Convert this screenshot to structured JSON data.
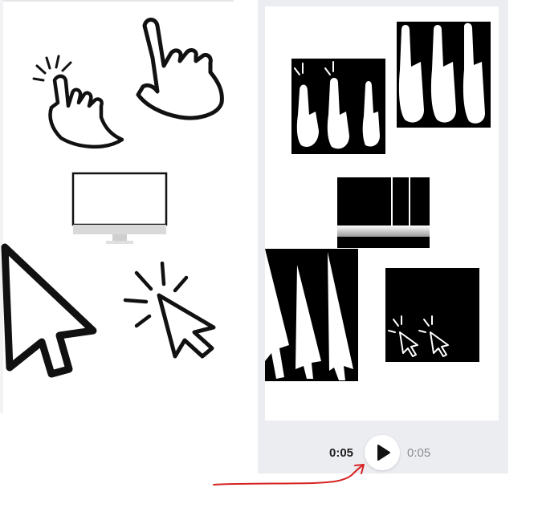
{
  "player": {
    "current_time": "0:05",
    "total_time": "0:05",
    "play_icon": "play-icon"
  },
  "icons": {
    "left_panel": [
      "tap-hand-icon",
      "pointing-hand-icon",
      "monitor-icon",
      "arrow-cursor-icon",
      "click-cursor-icon"
    ],
    "annotation": "red-arrow-icon"
  },
  "colors": {
    "panel_background": "#ecedf1",
    "annotation": "#d62222",
    "black": "#000000"
  }
}
